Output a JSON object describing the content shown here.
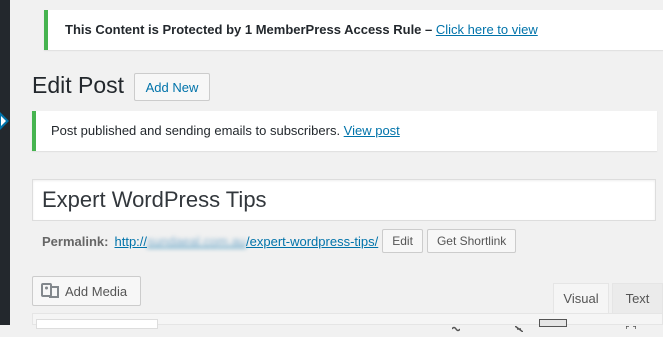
{
  "protected_notice": {
    "text": "This Content is Protected by 1 MemberPress Access Rule – ",
    "link": "Click here to view"
  },
  "page": {
    "title": "Edit Post",
    "add_new_label": "Add New"
  },
  "published_notice": {
    "text": "Post published and sending emails to subscribers. ",
    "link": "View post"
  },
  "post": {
    "title": "Expert WordPress Tips"
  },
  "permalink": {
    "label": "Permalink:",
    "url_prefix": "http://",
    "url_blurred": "sundaeal.com.au",
    "url_suffix": "/expert-wordpress-tips/",
    "edit_label": "Edit",
    "shortlink_label": "Get Shortlink"
  },
  "editor": {
    "add_media_label": "Add Media",
    "tab_visual": "Visual",
    "tab_text": "Text"
  },
  "colors": {
    "sidebar": "#23282d",
    "accent": "#0073aa",
    "success_border": "#46b450"
  }
}
